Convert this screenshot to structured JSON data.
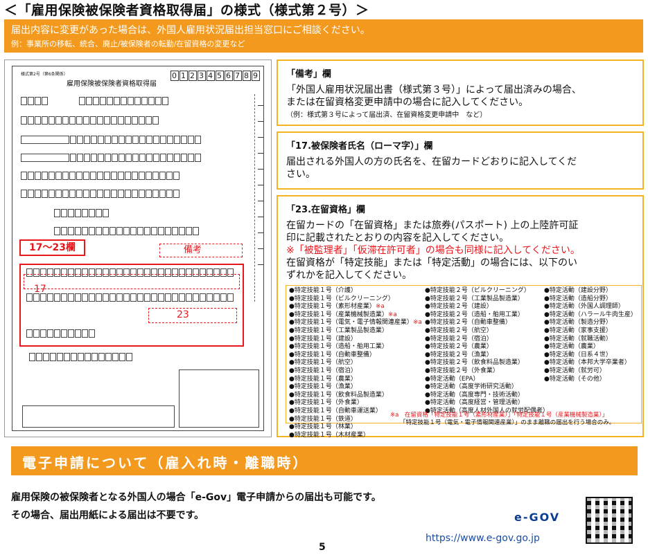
{
  "header": {
    "title": "＜「雇用保険被保険者資格取得届」の様式（様式第２号）＞"
  },
  "banner": {
    "line1": "届出内容に変更があった場合は、外国人雇用状況届出担当窓口にご相談ください。",
    "line2": "例：事業所の移転、統合、廃止/被保険者の転勤/在留資格の変更など"
  },
  "form": {
    "small_header": "様式第2号（第6条関係）",
    "title": "雇用保険被保険者資格取得届",
    "number_code": "0123456789",
    "label_17_23": "17～23欄",
    "label_biko": "備考",
    "label_17": "17",
    "label_23": "23"
  },
  "box_biko": {
    "heading": "「備考」欄",
    "line1": "「外国人雇用状況届出書（様式第３号）」によって届出済みの場合、",
    "line2": "または在留資格変更申請中の場合に記入してください。",
    "note": "（例：様式第３号によって届出済、在留資格変更申請中　など）"
  },
  "box_17": {
    "heading": "「17.被保険者氏名（ローマ字）」欄",
    "line1": "届出される外国人の方の氏名を、在留カードどおりに記入してくだ",
    "line2": "さい。"
  },
  "box_23": {
    "heading": "「23.在留資格」欄",
    "line1": "在留カードの「在留資格」または旅券(パスポート) 上の上陸許可証",
    "line2": "印に記載されたとおりの内容を記入してください。",
    "line3_red": "※「被監理者」「仮滞在許可者」の場合も同様に記入してください。",
    "line4": "在留資格が「特定技能」または「特定活動」の場合には、以下のい",
    "line5": "ずれかを記入してください。"
  },
  "visa_list": {
    "col1": [
      "●特定技能１号（介護）",
      "●特定技能１号（ビルクリーニング）",
      "●特定技能１号（素形材産業）※a",
      "●特定技能１号（産業機械製造業）※a",
      "●特定技能１号（電気・電子情報関連産業）※a",
      "●特定技能１号（工業製品製造業）",
      "●特定技能１号（建設）",
      "●特定技能１号（造船・舶用工業）",
      "●特定技能１号（自動車整備）",
      "●特定技能１号（航空）",
      "●特定技能１号（宿泊）",
      "●特定技能１号（農業）",
      "●特定技能１号（漁業）",
      "●特定技能１号（飲食料品製造業）",
      "●特定技能１号（外食業）",
      "●特定技能１号（自動車運送業）",
      "●特定技能１号（鉄道）",
      "●特定技能１号（林業）",
      "●特定技能１号（木材産業）"
    ],
    "col2": [
      "●特定技能２号（ビルクリーニング）",
      "●特定技能２号（工業製品製造業）",
      "●特定技能２号（建設）",
      "●特定技能２号（造船・舶用工業）",
      "●特定技能２号（自動車整備）",
      "●特定技能２号（航空）",
      "●特定技能２号（宿泊）",
      "●特定技能２号（農業）",
      "●特定技能２号（漁業）",
      "●特定技能２号（飲食料品製造業）",
      "●特定技能２号（外食業）",
      "●特定活動（EPA）",
      "●特定活動（高度学術研究活動）",
      "●特定活動（高度専門・技術活動）",
      "●特定活動（高度経営・管理活動）",
      "●特定活動（高度人材外国人の就労配偶者）"
    ],
    "col3": [
      "●特定活動（建設分野）",
      "●特定活動（造船分野）",
      "●特定活動（外国人調理師）",
      "●特定活動（ハラール牛肉生産）",
      "●特定活動（製造分野）",
      "●特定活動（家事支援）",
      "●特定活動（就職活動）",
      "●特定活動（農業）",
      "●特定活動（日系４世）",
      "●特定活動（本邦大学卒業者）",
      "●特定活動（就労可）",
      "●特定活動（その他）"
    ],
    "note_line1": "※a　在留資格「特定技能１号（素形材産業）」「特定技能１号（産業機械製造業）」",
    "note_line2": "「特定技能１号（電気・電子情報関連産業）」のまま離職の届出を行う場合のみ。"
  },
  "band": {
    "title": "電子申請について（雇入れ時・離職時）"
  },
  "bottom": {
    "line1": "雇用保険の被保険者となる外国人の場合「e-Gov」電子申請からの届出も可能です。",
    "line2": "その場合、届出用紙による届出は不要です。",
    "logo": "e-GOV",
    "url": "https://www.e-gov.go.jp",
    "page_number": "5"
  }
}
